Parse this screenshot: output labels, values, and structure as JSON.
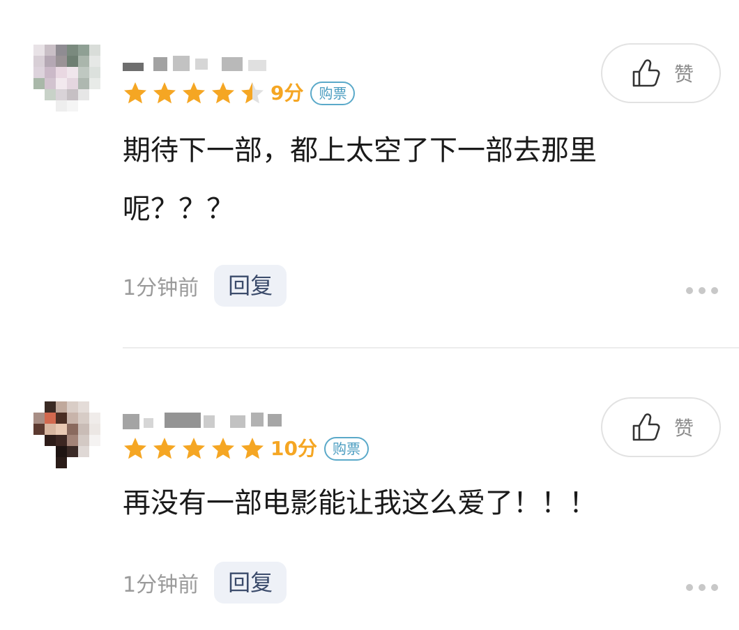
{
  "comments": [
    {
      "score_text": "9分",
      "rating": 4.5,
      "badge": "购票",
      "content": "期待下一部，都上太空了下一部去那里\n呢？？？",
      "time": "1分钟前",
      "reply_label": "回复",
      "like_label": "赞",
      "avatar_icon": "pixelated-avatar-icon"
    },
    {
      "score_text": "10分",
      "rating": 5,
      "badge": "购票",
      "content": "再没有一部电影能让我这么爱了！！！",
      "time": "1分钟前",
      "reply_label": "回复",
      "like_label": "赞",
      "avatar_icon": "pixelated-avatar-icon"
    }
  ],
  "colors": {
    "star": "#f5a623",
    "badge": "#4a9cc0",
    "reply_bg": "#eef1f7",
    "reply_text": "#3b4b6b",
    "time_text": "#9a9a9a"
  }
}
